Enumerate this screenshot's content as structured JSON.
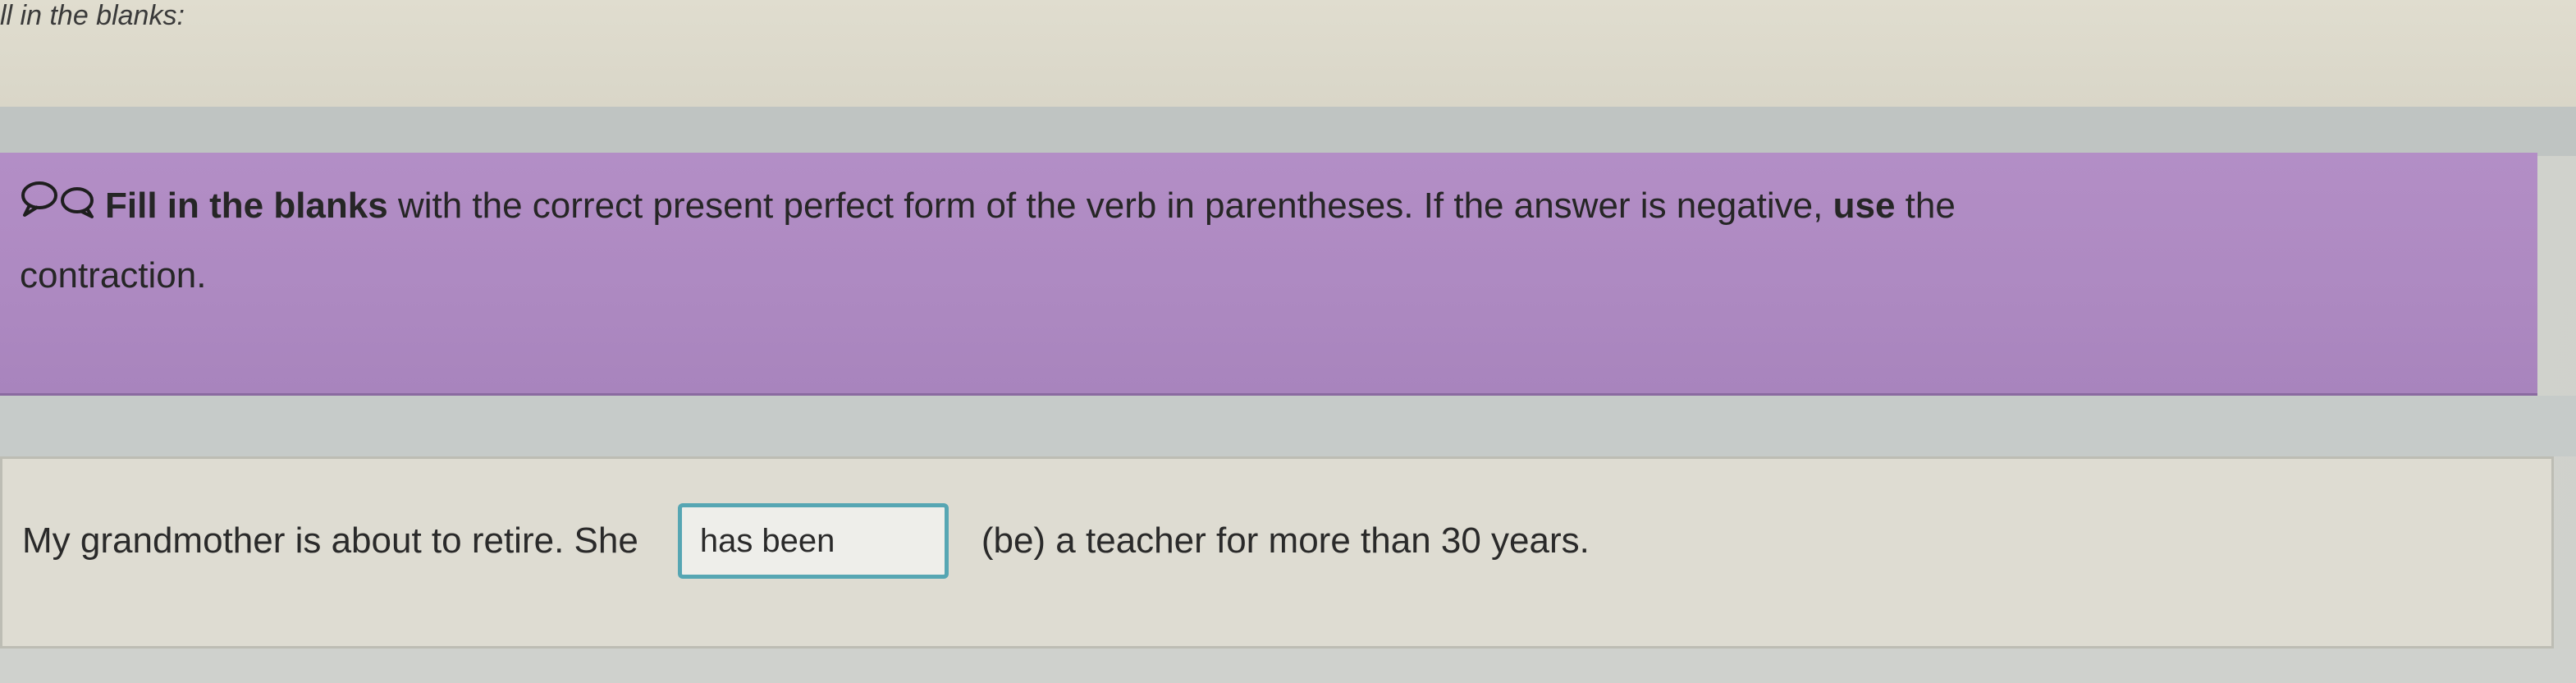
{
  "header": {
    "title": "ll in the blanks:"
  },
  "instructions": {
    "bold_lead": "Fill in the blanks",
    "text_part1": " with the correct present perfect form of the verb in parentheses. If the answer is negative, ",
    "bold_use": "use",
    "text_part2": " the",
    "line2": "contraction.",
    "icon": "speech-bubble-icon"
  },
  "question": {
    "before": "My grandmother is about to retire. She",
    "answer_value": "has been",
    "after": "(be) a teacher for more than 30 years."
  },
  "colors": {
    "instruction_bg": "#b08bc4",
    "input_border": "#56a6b3"
  }
}
